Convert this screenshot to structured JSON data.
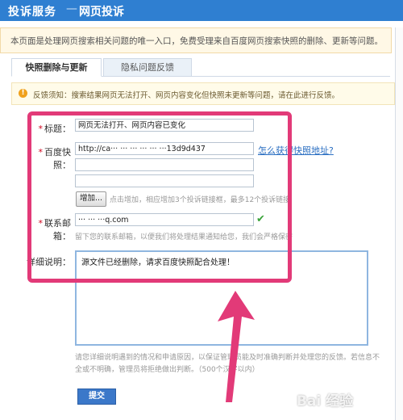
{
  "header": {
    "title": "投诉服务",
    "separator": "—",
    "subtitle": "网页投诉"
  },
  "notice": "本页面是处理网页搜索相关问题的唯一入口，免费受理来自百度网页搜索快照的删除、更新等问题。",
  "tabs": [
    {
      "label": "快照删除与更新",
      "active": true
    },
    {
      "label": "隐私问题反馈",
      "active": false
    }
  ],
  "tip": {
    "icon": "!",
    "text": "反馈须知：搜索结果网页无法打开、网页内容变化但快照未更新等问题，请在此进行反馈。"
  },
  "form": {
    "required_mark": "*",
    "title_label": "标题：",
    "title_value": "网页无法打开、网页内容已变化",
    "snapshot_label": "百度快照：",
    "snapshot_value_1": "http://ca··· ··· ··· ··· ··· ···13d9d437",
    "snapshot_value_2": "",
    "snapshot_value_3": "",
    "snapshot_link": "怎么获得快照地址?",
    "add_button": "增加...",
    "add_hint": "点击增加，相应增加3个投诉链接框，最多12个投诉链接",
    "email_label": "联系邮箱：",
    "email_value": "··· ··· ···q.com",
    "email_hint": "留下您的联系邮箱，以便我们将处理结果通知给您，我们会严格保密",
    "detail_label": "详细说明：",
    "detail_value": "源文件已经删除，请求百度快照配合处理！",
    "bottom_hint": "请您详细说明遇到的情况和申请原因，以保证管理员能及时准确判断并处理您的反馈。若信息不全或不明确，管理员将拒绝做出判断。（500个汉字以内）",
    "submit": "提交"
  },
  "watermark": "Bai 经验",
  "colors": {
    "header": "#2f7fd1",
    "highlight": "#e23a78",
    "submit": "#3b78c9",
    "link": "#2b6fc2"
  }
}
